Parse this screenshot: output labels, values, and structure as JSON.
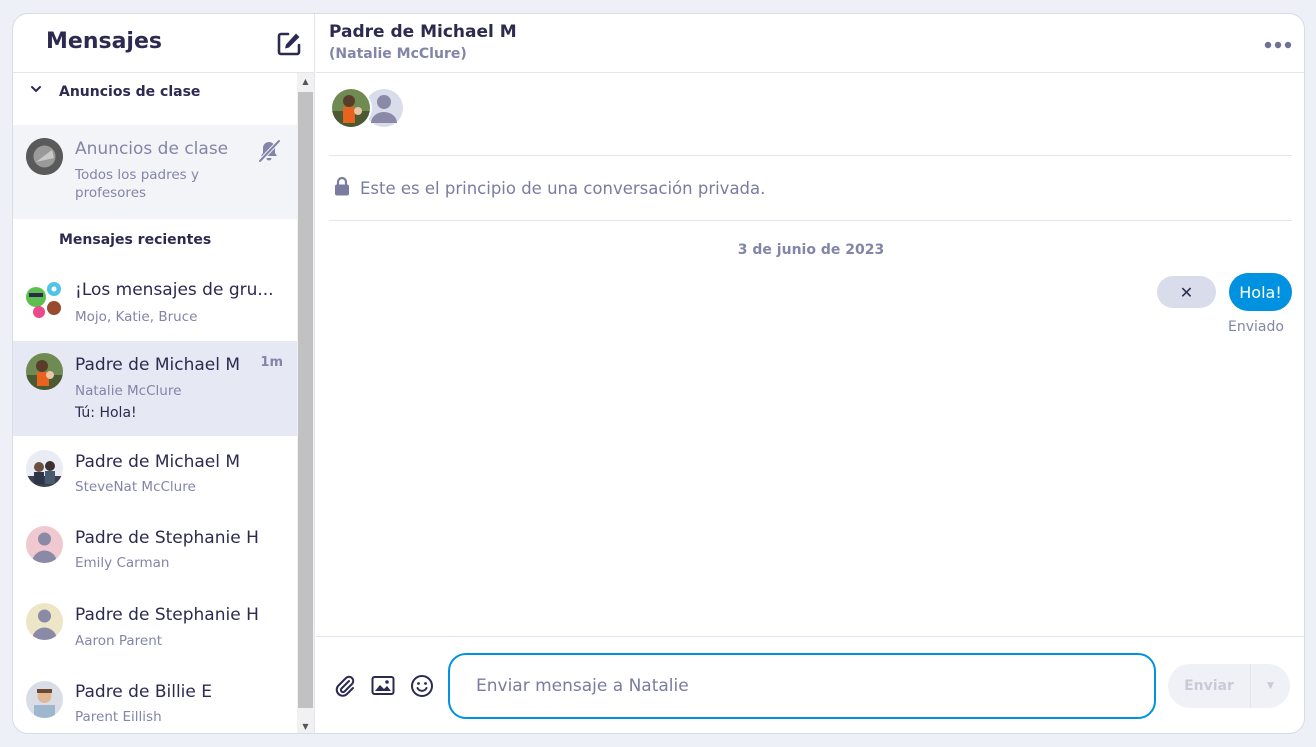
{
  "sidebar": {
    "title": "Mensajes",
    "section_announcements": "Anuncios de clase",
    "announcement": {
      "title": "Anuncios de clase",
      "subtitle": "Todos los padres y profesores"
    },
    "section_recent": "Mensajes recientes",
    "conversations": [
      {
        "title": "¡Los mensajes de gru...",
        "subtitle": "Mojo, Katie, Bruce"
      },
      {
        "title": "Padre de Michael M",
        "subtitle": "Natalie McClure",
        "preview": "Tú: Hola!",
        "time": "1m"
      },
      {
        "title": "Padre de Michael M",
        "subtitle": "SteveNat McClure"
      },
      {
        "title": "Padre de Stephanie H",
        "subtitle": "Emily Carman"
      },
      {
        "title": "Padre de Stephanie H",
        "subtitle": "Aaron Parent"
      },
      {
        "title": "Padre de Billie E",
        "subtitle": "Parent Eillish"
      }
    ]
  },
  "chat": {
    "title": "Padre de Michael M",
    "subtitle": "(Natalie McClure)",
    "private_notice": "Este es el principio de una conversación privada.",
    "date": "3 de junio de 2023",
    "message": "Hola!",
    "status": "Enviado",
    "cancel_label": "✕"
  },
  "composer": {
    "placeholder": "Enviar mensaje a Natalie",
    "send_label": "Enviar"
  },
  "icons": [
    "compose-icon",
    "chevron-down-icon",
    "bell-off-icon",
    "more-icon",
    "lock-icon",
    "paperclip-icon",
    "image-icon",
    "emoji-icon",
    "caret-down-icon"
  ],
  "colors": {
    "accent": "#0092e0",
    "text": "#2c2a50",
    "muted": "#8285a8",
    "active_row": "#e6e8f3"
  }
}
